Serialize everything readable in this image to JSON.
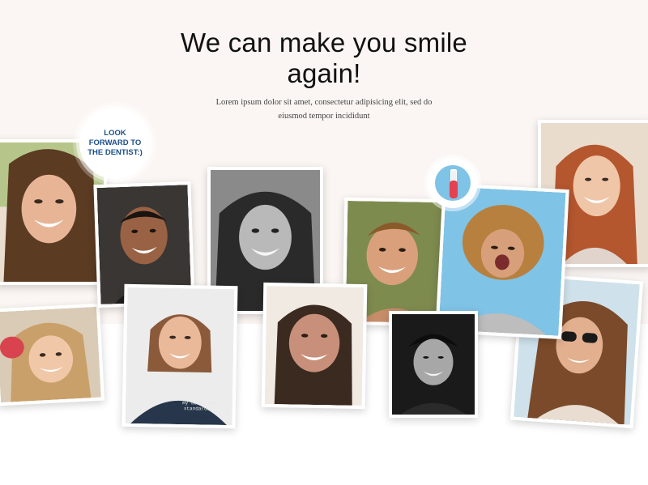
{
  "hero": {
    "headline": "We can make you smile again!",
    "subtext": "Lorem ipsum dolor sit amet, consectetur adipisicing elit, sed do eiusmod tempor incididunt"
  },
  "badge": {
    "text": "LOOK FORWARD TO THE DENTIST:)"
  },
  "photos": [
    {
      "name": "smiling-woman-photo-1"
    },
    {
      "name": "smiling-man-photo-2"
    },
    {
      "name": "smiling-woman-bw-photo-3"
    },
    {
      "name": "smiling-man-photo-4"
    },
    {
      "name": "smiling-woman-curly-photo-5"
    },
    {
      "name": "smiling-woman-redhead-photo-6"
    },
    {
      "name": "smiling-girl-photo-7"
    },
    {
      "name": "smiling-woman-shirt-photo-8"
    },
    {
      "name": "smiling-woman-photo-9"
    },
    {
      "name": "smiling-man-bw-photo-10"
    },
    {
      "name": "smiling-woman-sunglasses-photo-11"
    }
  ],
  "shirt_text": "my body, my standards.",
  "icons": [
    "toothbrush-icon"
  ],
  "colors": {
    "hero_bg": "#fbf6f3",
    "badge_text": "#1b4f8a",
    "brush_blue": "#7fc3e6",
    "brush_red": "#e5414f"
  }
}
